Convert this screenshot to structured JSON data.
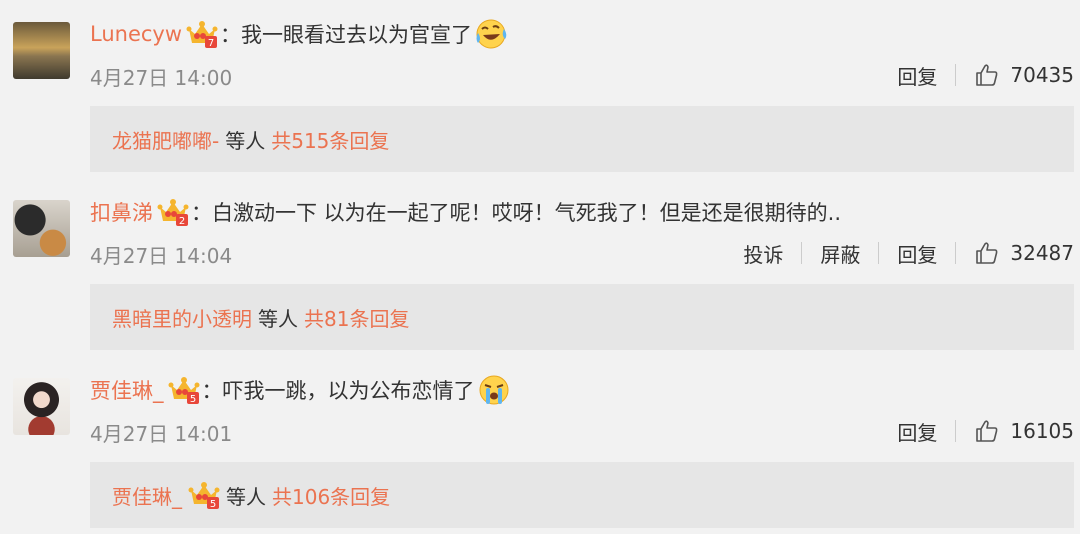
{
  "comments": [
    {
      "user": "Lunecyw",
      "crown_level": "7",
      "text": "我一眼看过去以为官宣了",
      "emoji": "laughing-crying-emoji",
      "time": "4月27日 14:00",
      "actions": [
        "回复"
      ],
      "likes": "70435",
      "replies": {
        "name": "龙猫肥嘟嘟-",
        "mid": "等人",
        "count": "共515条回复"
      }
    },
    {
      "user": "扣鼻涕",
      "crown_level": "2",
      "text": "白激动一下 以为在一起了呢！哎呀！气死我了！但是还是很期待的..",
      "emoji": "",
      "time": "4月27日 14:04",
      "actions": [
        "投诉",
        "屏蔽",
        "回复"
      ],
      "likes": "32487",
      "replies": {
        "name": "黑暗里的小透明",
        "mid": "等人",
        "count": "共81条回复"
      }
    },
    {
      "user": "贾佳琳_",
      "crown_level": "5",
      "text": "吓我一跳，以为公布恋情了",
      "emoji": "crying-emoji",
      "time": "4月27日 14:01",
      "actions": [
        "回复"
      ],
      "likes": "16105",
      "replies": {
        "name": "贾佳琳_",
        "mid": "等人",
        "count": "共106条回复"
      }
    }
  ],
  "colors": {
    "username": "#eb7350",
    "background": "#f2f2f2",
    "reply_box": "#e6e6e6",
    "meta": "#8a8a8a"
  }
}
